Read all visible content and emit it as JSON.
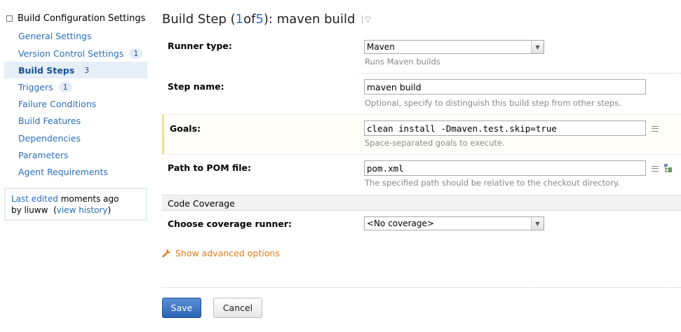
{
  "sidebar": {
    "title": "Build Configuration Settings",
    "items": [
      {
        "label": "General Settings",
        "badge": ""
      },
      {
        "label": "Version Control Settings",
        "badge": "1"
      },
      {
        "label": "Build Steps",
        "badge": "3"
      },
      {
        "label": "Triggers",
        "badge": "1"
      },
      {
        "label": "Failure Conditions",
        "badge": ""
      },
      {
        "label": "Build Features",
        "badge": ""
      },
      {
        "label": "Dependencies",
        "badge": ""
      },
      {
        "label": "Parameters",
        "badge": ""
      },
      {
        "label": "Agent Requirements",
        "badge": ""
      }
    ],
    "last_edited_label": "Last edited",
    "last_edited_value": "moments ago",
    "by_prefix": "by liuww",
    "view_history": "view history"
  },
  "header": {
    "prefix": "Build Step (",
    "current": "1",
    "of": " of ",
    "total": "5",
    "suffix": "): maven build"
  },
  "form": {
    "runner_type": {
      "label": "Runner type:",
      "value": "Maven",
      "note": "Runs Maven builds"
    },
    "step_name": {
      "label": "Step name:",
      "value": "maven build",
      "note": "Optional, specify to distinguish this build step from other steps."
    },
    "goals": {
      "label": "Goals:",
      "value": "clean install -Dmaven.test.skip=true",
      "note": "Space-separated goals to execute."
    },
    "pom_path": {
      "label": "Path to POM file:",
      "value": "pom.xml",
      "note": "The specified path should be relative to the checkout directory."
    },
    "coverage_section": "Code Coverage",
    "coverage_runner": {
      "label": "Choose coverage runner:",
      "value": "<No coverage>"
    },
    "advanced": "Show advanced options"
  },
  "buttons": {
    "save": "Save",
    "cancel": "Cancel"
  },
  "colors": {
    "link": "#2a6ebb",
    "accent_orange": "#e07b17",
    "save_button": "#2c63b5"
  }
}
